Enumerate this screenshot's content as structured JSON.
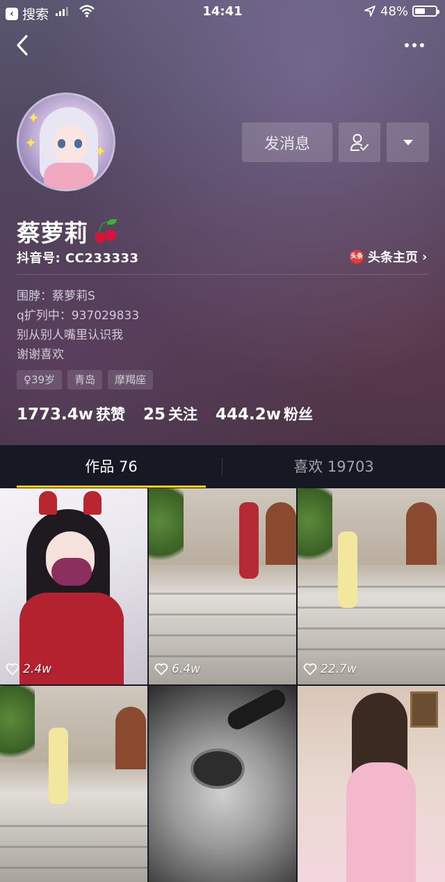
{
  "status_bar": {
    "back_app_label": "搜索",
    "time": "14:41",
    "battery": "48%"
  },
  "profile": {
    "name": "蔡萝莉",
    "douyin_id": "抖音号: CC233333",
    "toutiao_link": "头条主页",
    "toutiao_badge": "头条",
    "bio_lines": [
      "围脖：蔡萝莉S",
      "q扩列中：937029833",
      "别从别人嘴里认识我",
      "谢谢喜欢"
    ],
    "tags": [
      "♀39岁",
      "青岛",
      "摩羯座"
    ],
    "stats": [
      {
        "value": "1773.4w",
        "label": "获赞"
      },
      {
        "value": "25",
        "label": "关注"
      },
      {
        "value": "444.2w",
        "label": "粉丝"
      }
    ]
  },
  "actions": {
    "message_label": "发消息"
  },
  "tabs": [
    {
      "label": "作品 76",
      "active": true
    },
    {
      "label": "喜欢 19703",
      "active": false
    }
  ],
  "videos": [
    {
      "likes": "2.4w"
    },
    {
      "likes": "6.4w"
    },
    {
      "likes": "22.7w"
    },
    {
      "likes": ""
    },
    {
      "likes": ""
    },
    {
      "likes": ""
    }
  ],
  "colors": {
    "accent": "#face15",
    "background": "#161823",
    "toutiao_badge": "#e33a3a"
  }
}
